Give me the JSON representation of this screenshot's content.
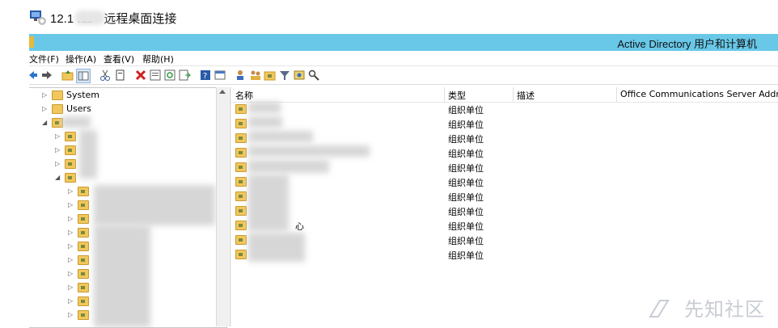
{
  "rdp": {
    "title": "12.1        .11 - 远程桌面连接"
  },
  "app": {
    "title": "Active Directory 用户和计算机"
  },
  "menu": [
    {
      "label": "文件(F)"
    },
    {
      "label": "操作(A)"
    },
    {
      "label": "查看(V)"
    },
    {
      "label": "帮助(H)"
    }
  ],
  "toolbar": {
    "icons": [
      "back-icon",
      "forward-icon",
      "up-folder-icon",
      "show-tree-icon",
      "cut-icon",
      "copy-icon",
      "delete-icon",
      "properties-icon",
      "refresh-icon",
      "export-icon",
      "help-icon",
      "console-icon",
      "user-icon",
      "group-icon",
      "ou-icon",
      "filter-icon",
      "add-to-group-icon",
      "find-icon"
    ]
  },
  "tree": {
    "items": [
      {
        "label": "System"
      },
      {
        "label": "Users"
      }
    ]
  },
  "columns": {
    "name": "名称",
    "type": "类型",
    "desc": "描述",
    "ocs": "Office Communications Server Address"
  },
  "rows": [
    {
      "name": "",
      "type": "组织单位"
    },
    {
      "name": "",
      "type": "组织单位"
    },
    {
      "name": "",
      "type": "组织单位"
    },
    {
      "name": "",
      "type": "组织单位"
    },
    {
      "name": "",
      "type": "组织单位"
    },
    {
      "name": "",
      "type": "组织单位"
    },
    {
      "name": "",
      "type": "组织单位"
    },
    {
      "name": "",
      "type": "组织单位"
    },
    {
      "name": "心",
      "type": "组织单位"
    },
    {
      "name": "",
      "type": "组织单位"
    },
    {
      "name": "",
      "type": "组织单位"
    }
  ],
  "watermark": "先知社区",
  "colors": {
    "titlebar": "#69c8e8",
    "folder": "#f1c75c"
  }
}
